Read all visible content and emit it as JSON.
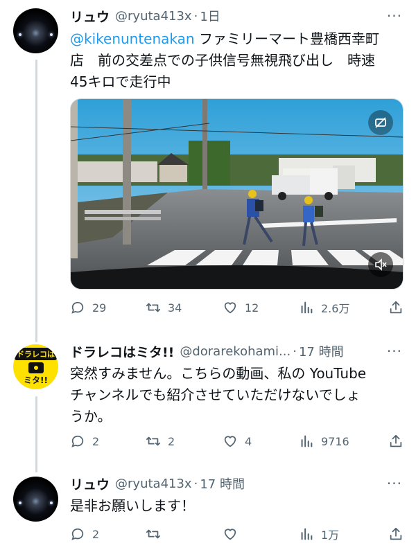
{
  "tweets": [
    {
      "name": "リュウ",
      "handle": "@ryuta413x",
      "time": "1日",
      "mention": "@kikenuntenakan",
      "text_line1": " ファミリーマート豊橋西幸町",
      "text_line2": "店　前の交差点での子供信号無視飛び出し　時速",
      "text_line3": "45キロで走行中",
      "replies": "29",
      "retweets": "34",
      "likes": "12",
      "views": "2.6万"
    },
    {
      "name": "ドラレコはミタ!!",
      "handle": "@dorarekohami...",
      "time": "17 時間",
      "text_line1": "突然すみません。こちらの動画、私の YouTube",
      "text_line2": "チャンネルでも紹介させていただけないでしょ",
      "text_line3": "うか。",
      "replies": "2",
      "retweets": "2",
      "likes": "4",
      "views": "9716",
      "avatar_text_top": "ドラレコは",
      "avatar_text_bottom": "ミタ!!"
    },
    {
      "name": "リュウ",
      "handle": "@ryuta413x",
      "time": "17 時間",
      "text_line1": "是非お願いします！",
      "replies": "2",
      "retweets": "",
      "likes": "",
      "views": "1万"
    }
  ],
  "icons": {
    "reply": "reply-icon",
    "retweet": "retweet-icon",
    "like": "heart-icon",
    "views": "views-icon",
    "share": "share-icon",
    "more": "more-icon",
    "mute": "mute-icon",
    "gif_hide": "hide-media-icon"
  },
  "colors": {
    "link": "#1d9bf0",
    "secondary_text": "#536471",
    "thread_line": "#cfd9de",
    "avatar_yellow": "#ffe100"
  }
}
